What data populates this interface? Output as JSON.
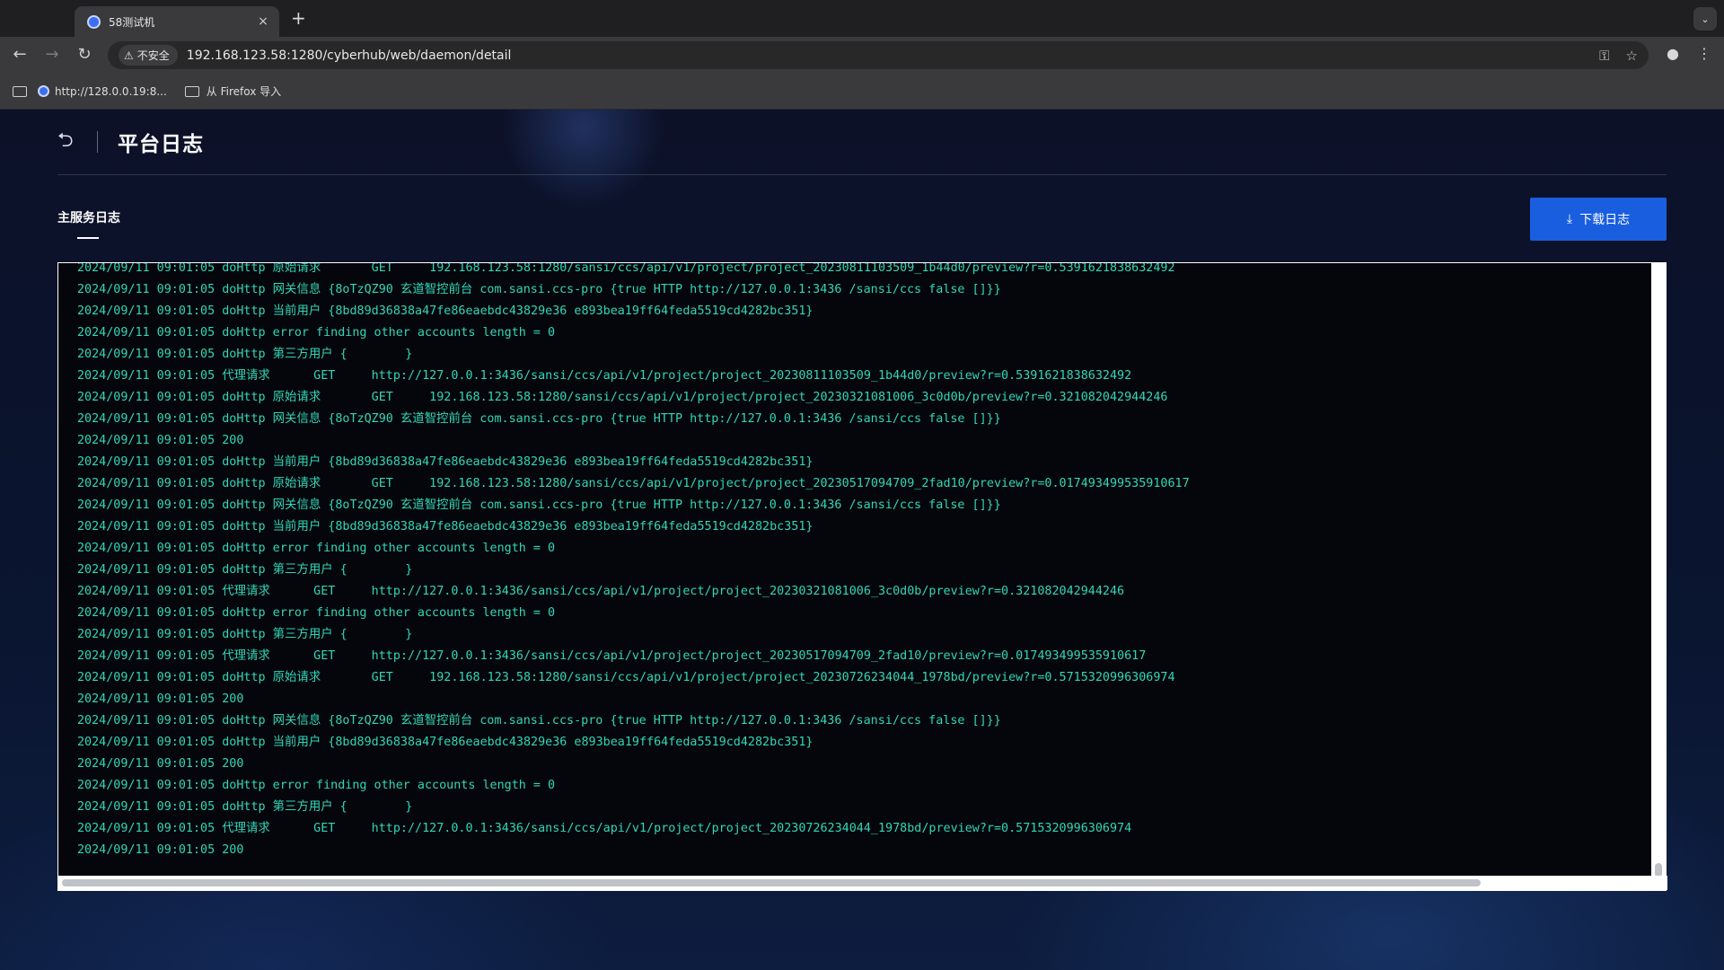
{
  "browser": {
    "tab_title": "58测试机",
    "tab_close": "×",
    "new_tab": "+",
    "tab_menu": "⌄",
    "security_label": "不安全",
    "url": "192.168.123.58:1280/cyberhub/web/daemon/detail",
    "bookmarks": [
      {
        "label": "http://128.0.0.19:8..."
      },
      {
        "label": "从 Firefox 导入"
      }
    ]
  },
  "page": {
    "title": "平台日志",
    "active_tab": "主服务日志",
    "download_label": "下载日志"
  },
  "log": {
    "lines": [
      "2024/09/11 09:01:05 doHttp 原始请求       GET     192.168.123.58:1280/sansi/ccs/api/v1/project/project_20230811103509_1b44d0/preview?r=0.5391621838632492",
      "2024/09/11 09:01:05 doHttp 网关信息 {8oTzQZ90 玄道智控前台 com.sansi.ccs-pro {true HTTP http://127.0.0.1:3436 /sansi/ccs false []}}",
      "2024/09/11 09:01:05 doHttp 当前用户 {8bd89d36838a47fe86eaebdc43829e36 e893bea19ff64feda5519cd4282bc351}",
      "2024/09/11 09:01:05 doHttp error finding other accounts length = 0",
      "2024/09/11 09:01:05 doHttp 第三方用户 {        }",
      "2024/09/11 09:01:05 代理请求      GET     http://127.0.0.1:3436/sansi/ccs/api/v1/project/project_20230811103509_1b44d0/preview?r=0.5391621838632492",
      "2024/09/11 09:01:05 doHttp 原始请求       GET     192.168.123.58:1280/sansi/ccs/api/v1/project/project_20230321081006_3c0d0b/preview?r=0.321082042944246",
      "2024/09/11 09:01:05 doHttp 网关信息 {8oTzQZ90 玄道智控前台 com.sansi.ccs-pro {true HTTP http://127.0.0.1:3436 /sansi/ccs false []}}",
      "2024/09/11 09:01:05 200",
      "2024/09/11 09:01:05 doHttp 当前用户 {8bd89d36838a47fe86eaebdc43829e36 e893bea19ff64feda5519cd4282bc351}",
      "2024/09/11 09:01:05 doHttp 原始请求       GET     192.168.123.58:1280/sansi/ccs/api/v1/project/project_20230517094709_2fad10/preview?r=0.017493499535910617",
      "2024/09/11 09:01:05 doHttp 网关信息 {8oTzQZ90 玄道智控前台 com.sansi.ccs-pro {true HTTP http://127.0.0.1:3436 /sansi/ccs false []}}",
      "2024/09/11 09:01:05 doHttp 当前用户 {8bd89d36838a47fe86eaebdc43829e36 e893bea19ff64feda5519cd4282bc351}",
      "2024/09/11 09:01:05 doHttp error finding other accounts length = 0",
      "2024/09/11 09:01:05 doHttp 第三方用户 {        }",
      "2024/09/11 09:01:05 代理请求      GET     http://127.0.0.1:3436/sansi/ccs/api/v1/project/project_20230321081006_3c0d0b/preview?r=0.321082042944246",
      "2024/09/11 09:01:05 doHttp error finding other accounts length = 0",
      "2024/09/11 09:01:05 doHttp 第三方用户 {        }",
      "2024/09/11 09:01:05 代理请求      GET     http://127.0.0.1:3436/sansi/ccs/api/v1/project/project_20230517094709_2fad10/preview?r=0.017493499535910617",
      "2024/09/11 09:01:05 doHttp 原始请求       GET     192.168.123.58:1280/sansi/ccs/api/v1/project/project_20230726234044_1978bd/preview?r=0.5715320996306974",
      "2024/09/11 09:01:05 200",
      "2024/09/11 09:01:05 doHttp 网关信息 {8oTzQZ90 玄道智控前台 com.sansi.ccs-pro {true HTTP http://127.0.0.1:3436 /sansi/ccs false []}}",
      "2024/09/11 09:01:05 doHttp 当前用户 {8bd89d36838a47fe86eaebdc43829e36 e893bea19ff64feda5519cd4282bc351}",
      "2024/09/11 09:01:05 200",
      "2024/09/11 09:01:05 doHttp error finding other accounts length = 0",
      "2024/09/11 09:01:05 doHttp 第三方用户 {        }",
      "2024/09/11 09:01:05 代理请求      GET     http://127.0.0.1:3436/sansi/ccs/api/v1/project/project_20230726234044_1978bd/preview?r=0.5715320996306974",
      "2024/09/11 09:01:05 200"
    ]
  },
  "colors": {
    "log_text": "#33d6b8",
    "log_bg": "#04060b",
    "accent": "#1a5ee0"
  }
}
